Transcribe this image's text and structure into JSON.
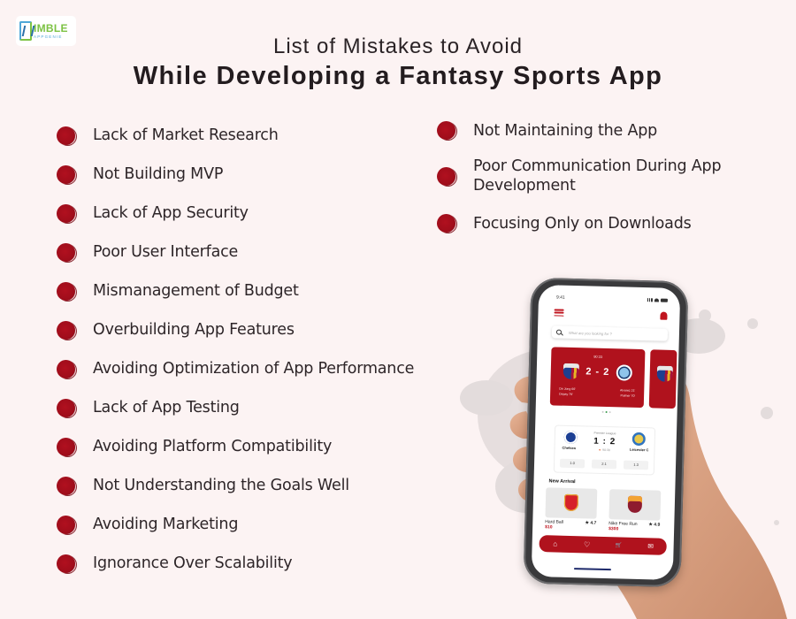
{
  "brand": {
    "name_line1": "IMBLE",
    "name_line2": "APPGENIE",
    "colors": {
      "green": "#7cc243",
      "blue": "#4fa7d8"
    }
  },
  "header": {
    "subtitle": "List of Mistakes to Avoid",
    "title": "While Developing a Fantasy Sports App"
  },
  "theme": {
    "accent": "#a00d1b",
    "background": "#fcf3f3",
    "text": "#2d2528"
  },
  "mistakes_left": [
    "Lack of Market Research",
    "Not Building MVP",
    "Lack of App Security",
    "Poor User Interface",
    "Mismanagement of Budget",
    "Overbuilding App Features",
    "Avoiding Optimization of App Performance",
    "Lack of App Testing",
    "Avoiding Platform Compatibility",
    "Not Understanding the Goals Well",
    "Avoiding Marketing",
    "Ignorance Over Scalability"
  ],
  "mistakes_right": [
    "Not Maintaining the App",
    "Poor Communication During App Development",
    "Focusing Only on Downloads"
  ],
  "phone_app": {
    "status_time": "9:41",
    "search_placeholder": "What are you looking for ?",
    "featured_match": {
      "time": "90:33",
      "score": "2 - 2",
      "home_crest": "barcelona-crest-icon",
      "away_crest": "man-city-crest-icon",
      "home_scorers": [
        "De Jong 66'",
        "Depay 79'"
      ],
      "away_scorers": [
        "Alvarez 21'",
        "Palmer 70'"
      ]
    },
    "carousel_dots": 3,
    "carousel_active": 1,
    "league_match": {
      "league": "Premier League",
      "score": "1 : 2",
      "live_time": "90:30",
      "home": "Chelsea",
      "away": "Leicester C",
      "odds": [
        "1.0",
        "2.1",
        "1.3"
      ]
    },
    "section_title": "New Arrival",
    "products": [
      {
        "name": "Hard Ball",
        "price": "$10",
        "rating": "4.7",
        "crest": "arsenal-crest-icon"
      },
      {
        "name": "Nike Free Run",
        "price": "$300",
        "rating": "4.9",
        "crest": "roma-crest-icon"
      }
    ],
    "tabs": [
      {
        "name": "home",
        "glyph": "⌂"
      },
      {
        "name": "favorites",
        "glyph": "♡"
      },
      {
        "name": "cart",
        "glyph": "🛒"
      },
      {
        "name": "messages",
        "glyph": "✉"
      }
    ]
  }
}
